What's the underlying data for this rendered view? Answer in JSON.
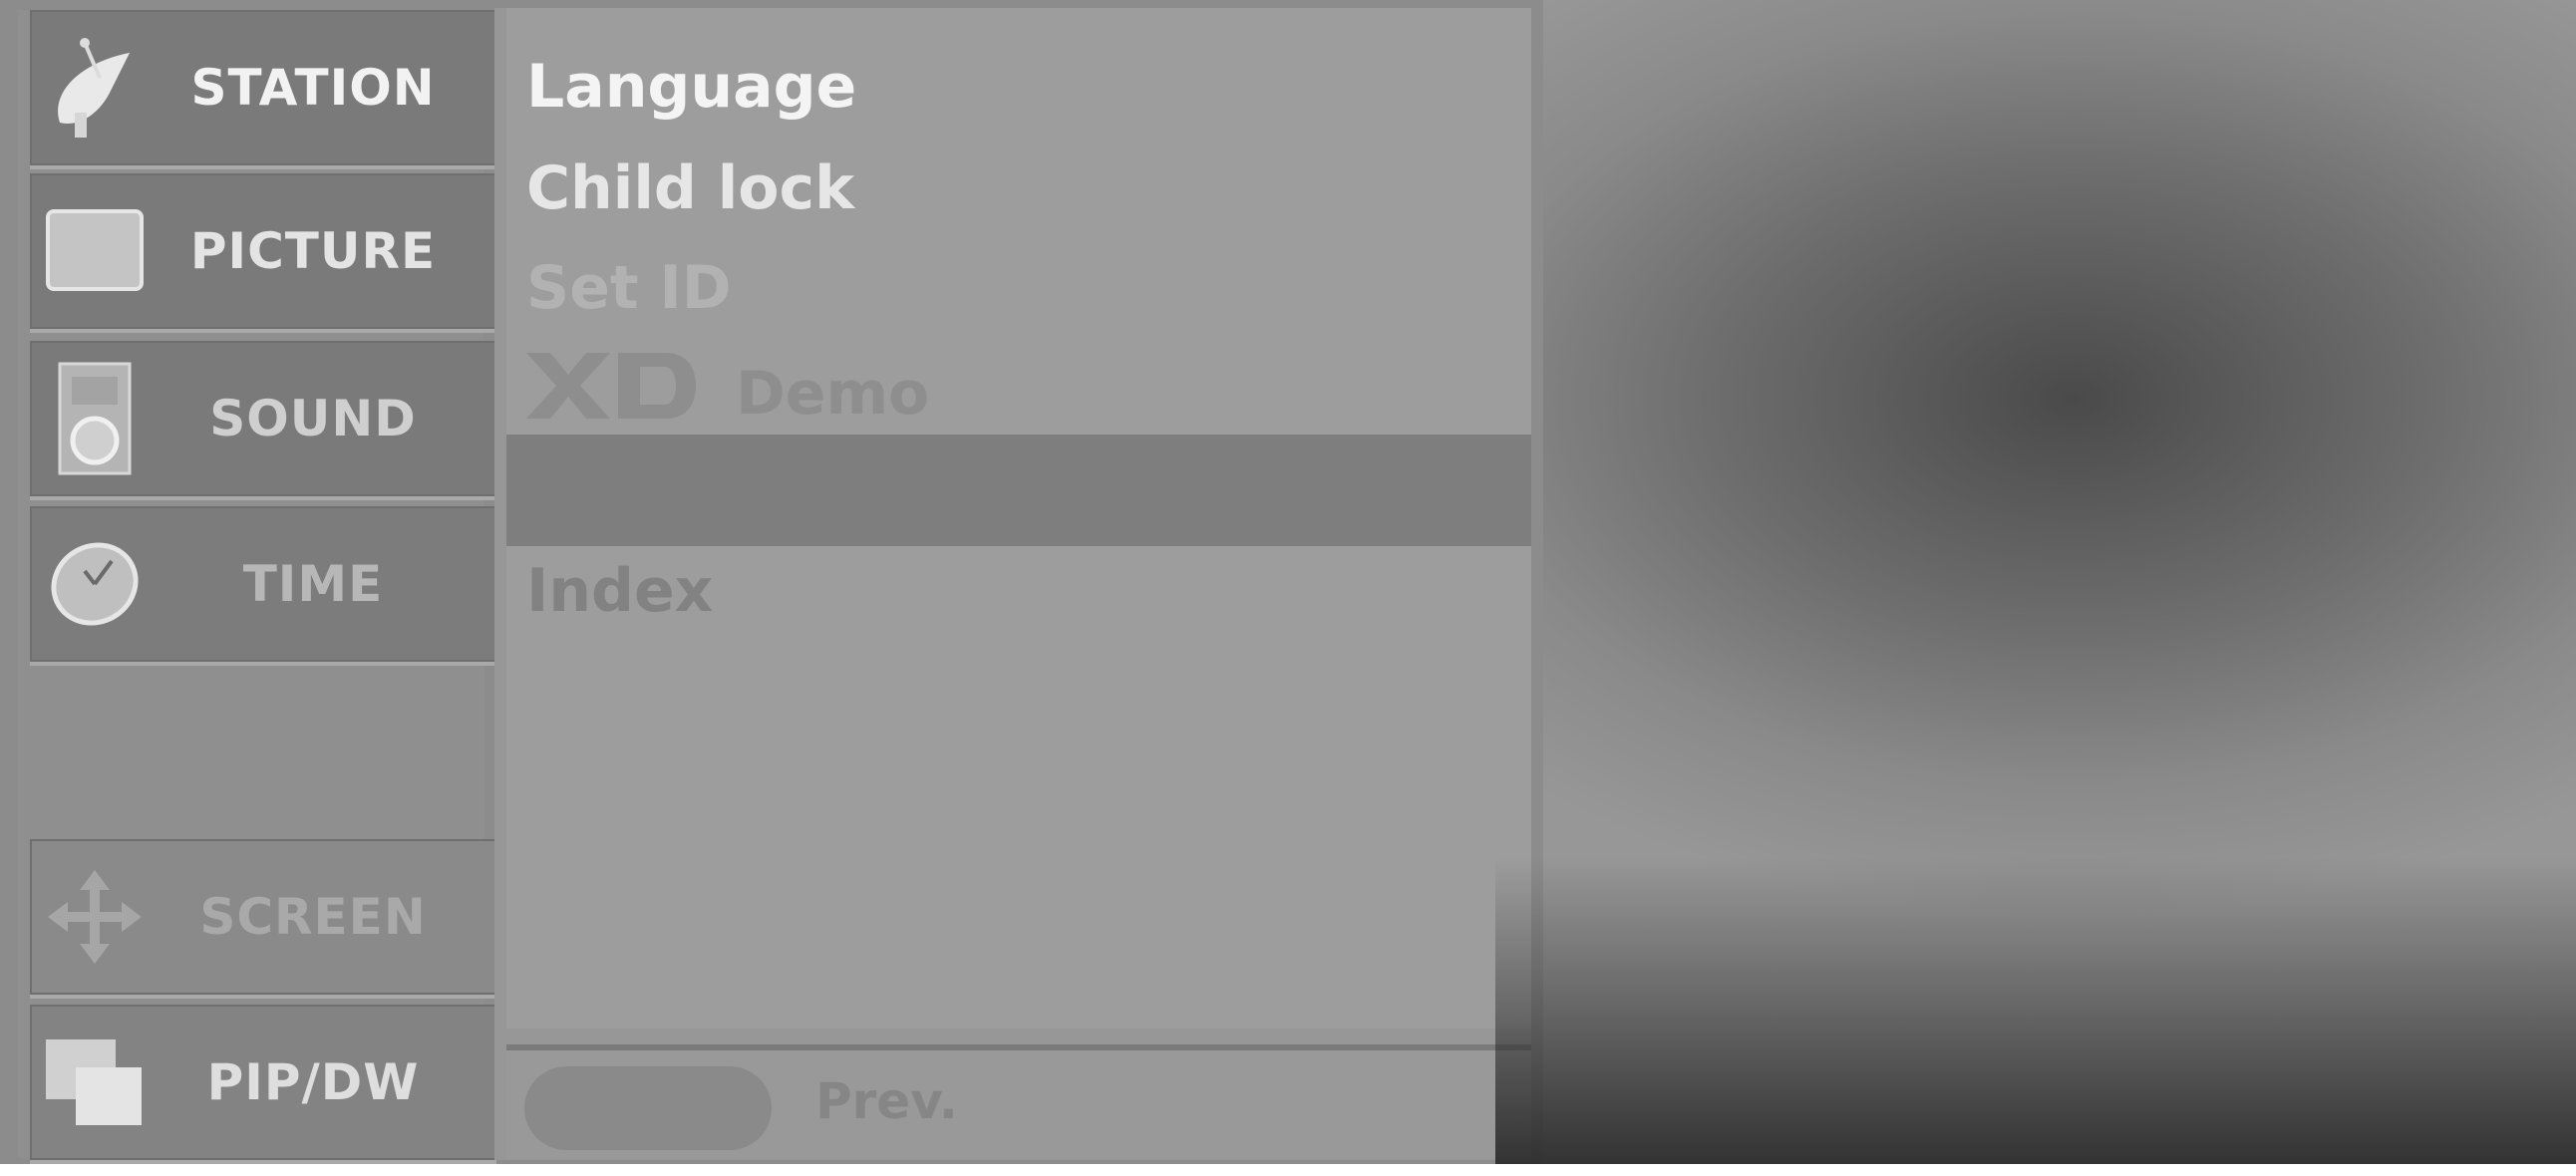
{
  "sidebar": {
    "items": [
      {
        "label": "STATION",
        "icon": "satellite-dish-icon"
      },
      {
        "label": "PICTURE",
        "icon": "tv-screen-icon"
      },
      {
        "label": "SOUND",
        "icon": "speaker-icon"
      },
      {
        "label": "TIME",
        "icon": "clock-icon"
      },
      {
        "label": "SCREEN",
        "icon": "move-arrows-icon"
      },
      {
        "label": "PIP/DW",
        "icon": "pip-windows-icon"
      }
    ]
  },
  "options": {
    "items": [
      {
        "label": "Language"
      },
      {
        "label": "Child lock"
      },
      {
        "label": "Set ID"
      },
      {
        "label": "Demo",
        "badge": "XD"
      },
      {
        "label": "Index"
      }
    ]
  },
  "footer": {
    "prev_label": "Prev."
  }
}
